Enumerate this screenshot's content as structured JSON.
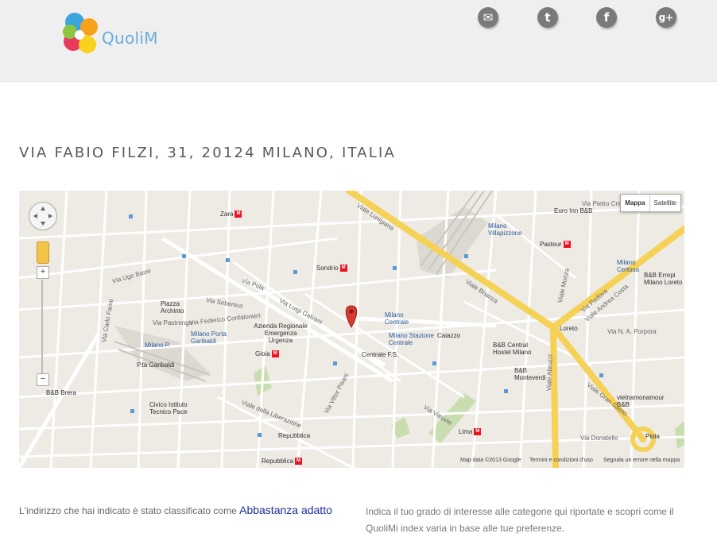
{
  "brand": {
    "name": "QuoliM"
  },
  "social": [
    {
      "name": "email-icon",
      "glyph": "✉"
    },
    {
      "name": "twitter-icon",
      "glyph": "t"
    },
    {
      "name": "facebook-icon",
      "glyph": "f"
    },
    {
      "name": "googleplus-icon",
      "glyph": "g+"
    }
  ],
  "address_title": "Via Fabio Filzi, 31, 20124 Milano, Italia",
  "map": {
    "type_buttons": {
      "map": "Mappa",
      "satellite": "Satellite"
    },
    "zoom_in": "+",
    "zoom_out": "−",
    "attribution": {
      "data": "Map data ©2013 Google",
      "terms": "Termini e condizioni d'uso",
      "report": "Segnala un errore nella mappa"
    },
    "labels": {
      "zara": "Zara",
      "sondrio": "Sondrio",
      "gioia": "Gioia",
      "centrale": "Centrale F.S.",
      "caiazzo": "Caiazzo",
      "pasteur": "Pasteur",
      "loreto": "Loreto",
      "lima": "Lima",
      "repubblica": "Repubblica",
      "piola": "Piola",
      "garibaldi": "P.ta Garibaldi",
      "milano_centrale": "Milano Centrale",
      "milano_stazione": "Milano Stazione Centrale",
      "milano_porta_garibaldi": "Milano Porta Garibaldi",
      "milano_villapizzone": "Milano Villapizzone",
      "milano_certosa": "Milano Certosa",
      "milano_p_garibaldi": "Milano P.",
      "piazza_archinto": "Piazza Archinto",
      "azienda": "Azienda Regionale Emergenza Urgenza",
      "bb_central": "B&B Central Hostel Milano",
      "bb_monteverdi": "B&B Monteverdi",
      "bb_errepi": "B&B Errepi Milano Loreto",
      "euro_inn": "Euro Inn B&B",
      "vietnamonamour": "vietnamonamour B&B",
      "civico": "Civico Istituto Tecnico Pace",
      "bb_brera": "B&B Brera",
      "repubblica2": "Repubblica",
      "viale_lunigiana": "Viale Lunigiana",
      "viale_brianza": "Viale Brianza",
      "via_pola": "Via Pola",
      "via_luigi_galvani": "Via Luigi Galvani",
      "viale_monza": "Viale Monza",
      "viale_abruzzi": "Viale Abruzzi",
      "viale_gran_sasso": "Viale Gran Sasso",
      "viale_andrea_costa": "Viale Andrea Costa",
      "via_n_a_porpora": "Via N. A. Porpora",
      "via_vittor_pisani": "Via Vittor Pisani",
      "via_vitruvio": "Via Vitruvio",
      "via_sebenico": "Via Sebenico",
      "via_federico_confalonieri": "Via Federico Confalonieri",
      "via_pastrengo": "Via Pastrengo",
      "via_carlo_farini": "Via Carlo Farini",
      "via_ugo_bassi": "Via Ugo Bassi",
      "viale_della_liberazione": "Viale della Liberazione",
      "via_dante": "Via Donatello",
      "via_pietro_crespi": "Via Pietro Crespi",
      "via_padova": "Via Padova"
    }
  },
  "footer": {
    "left_text": "L'indirizzo che hai indicato è stato classificato come",
    "rank": "Abbastanza adatto",
    "right_text": "Indica il tuo grado di interesse alle categorie qui riportate e scopri come il QuoliMi index varia in base alle tue preferenze."
  },
  "colors": {
    "map_bg": "#eeeae4",
    "highway": "#f5d155",
    "link": "#1b2c9a",
    "logo_text": "#6aaed8"
  }
}
